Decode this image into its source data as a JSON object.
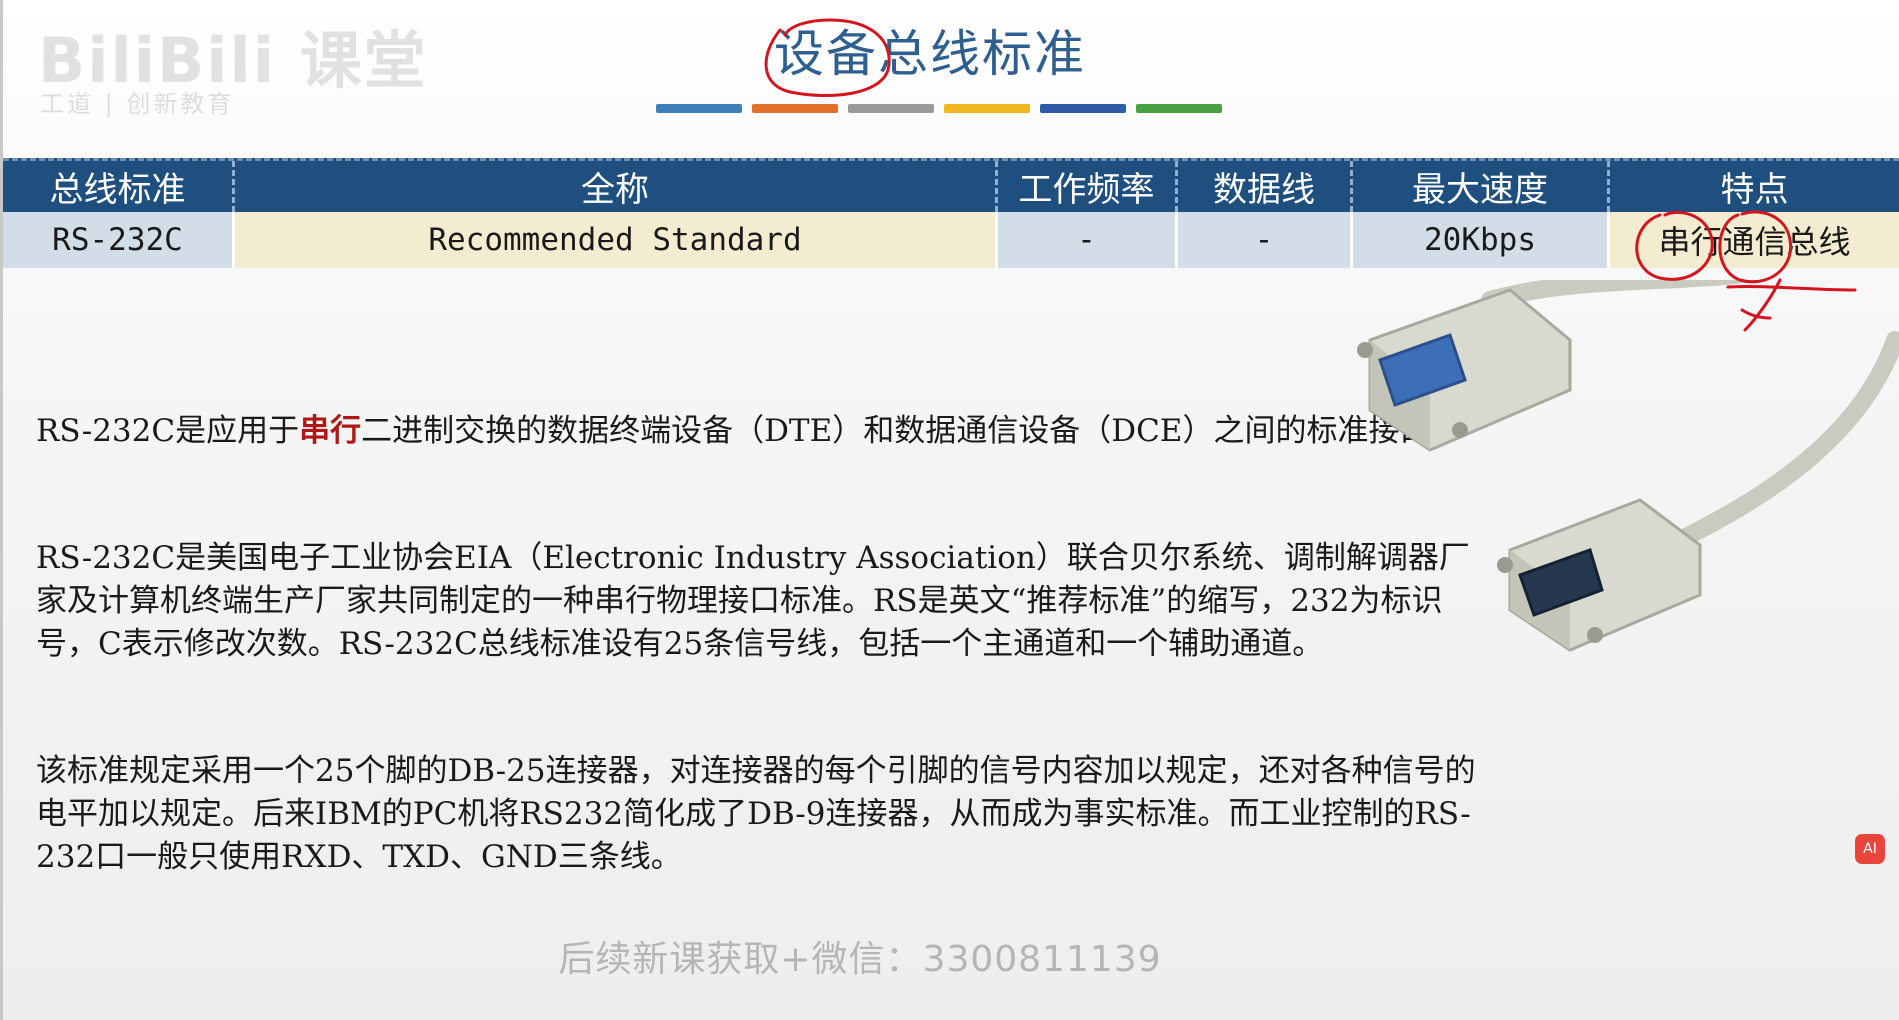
{
  "watermark": {
    "logo": "BiliBili 课堂",
    "sub": "工道 | 创新教育"
  },
  "title": "设备总线标准",
  "title_bar_colors": [
    "#3e7fb8",
    "#e0702a",
    "#9a9a9a",
    "#f0b820",
    "#2f5aa8",
    "#4aa040"
  ],
  "table": {
    "headers": [
      "总线标准",
      "全称",
      "工作频率",
      "数据线",
      "最大速度",
      "特点"
    ],
    "rows": [
      {
        "standard": "RS-232C",
        "full_name": "Recommended Standard",
        "frequency": "-",
        "data_lines": "-",
        "max_speed": "20Kbps",
        "feature": "串行通信总线"
      }
    ]
  },
  "paragraphs": {
    "p1_prefix": "RS-232C是应用于",
    "p1_highlight": "串行",
    "p1_suffix": "二进制交换的数据终端设备（DTE）和数据通信设备（DCE）之间的标准接口。",
    "p2": "RS-232C是美国电子工业协会EIA（Electronic Industry Association）联合贝尔系统、调制解调器厂家及计算机终端生产厂家共同制定的一种串行物理接口标准。RS是英文“推荐标准”的缩写，232为标识号，C表示修改次数。RS-232C总线标准设有25条信号线，包括一个主通道和一个辅助通道。",
    "p3": "该标准规定采用一个25个脚的DB-25连接器，对连接器的每个引脚的信号内容加以规定，还对各种信号的电平加以规定。后来IBM的PC机将RS232简化成了DB-9连接器，从而成为事实标准。而工业控制的RS-232口一般只使用RXD、TXD、GND三条线。"
  },
  "footer_note": "后续新课获取+微信：3300811139",
  "colors": {
    "header_bg": "#1f4f7f",
    "title": "#2e5f8f",
    "highlight": "#b01818",
    "annotation": "#d4141e"
  },
  "side_button_label": "AI"
}
